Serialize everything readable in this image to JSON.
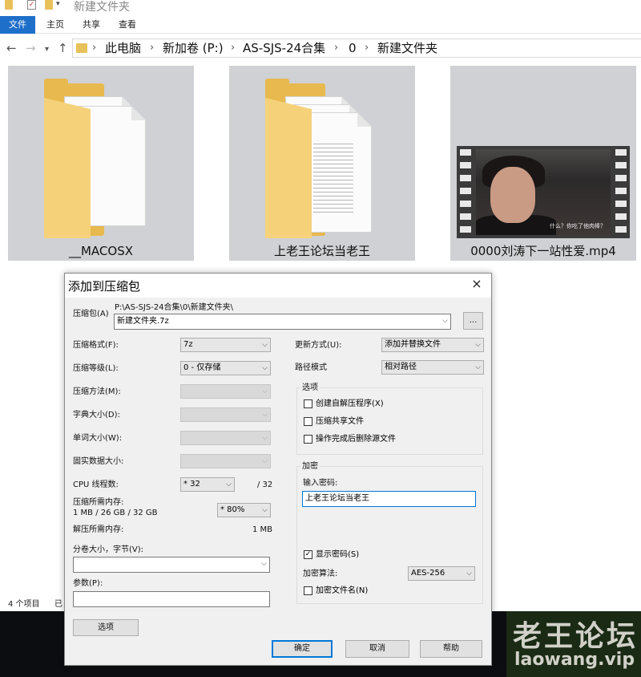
{
  "explorer": {
    "window_title": "新建文件夹",
    "ribbon_tabs": [
      "文件",
      "主页",
      "共享",
      "查看"
    ],
    "breadcrumbs": [
      "此电脑",
      "新加卷 (P:)",
      "AS-SJS-24合集",
      "0",
      "新建文件夹"
    ],
    "files": [
      {
        "name": "__MACOSX",
        "type": "folder-empty"
      },
      {
        "name": "上老王论坛当老王",
        "type": "folder-docs"
      },
      {
        "name": "0000刘涛下一站性爱.mp4",
        "type": "video",
        "subtitle": "什么？你吃了他肉棒？"
      }
    ],
    "status": {
      "count": "4 个项目",
      "selected": "已"
    }
  },
  "watermark": {
    "cn": "老王论坛",
    "en": "laowang.vip"
  },
  "dialog": {
    "title": "添加到压缩包",
    "archive_label": "压缩包(A)",
    "archive_path": "P:\\AS-SJS-24合集\\0\\新建文件夹\\",
    "archive_name": "新建文件夹.7z",
    "browse_label": "...",
    "format_label": "压缩格式(F):",
    "format_value": "7z",
    "level_label": "压缩等级(L):",
    "level_value": "0 - 仅存储",
    "method_label": "压缩方法(M):",
    "dict_label": "字典大小(D):",
    "word_label": "单词大小(W):",
    "solid_label": "固实数据大小:",
    "cpu_label": "CPU 线程数:",
    "cpu_value": "* 32",
    "cpu_total": "/ 32",
    "mem_label": "压缩所需内存:",
    "mem_detail": "1 MB / 26 GB / 32 GB",
    "mem_value": "* 80%",
    "decomp_label": "解压所需内存:",
    "decomp_value": "1 MB",
    "volume_label": "分卷大小，字节(V):",
    "volume_value": "",
    "params_label": "参数(P):",
    "params_value": "",
    "options_button": "选项",
    "update_label": "更新方式(U):",
    "update_value": "添加并替换文件",
    "path_label": "路径模式",
    "path_value": "相对路径",
    "options_group": "选项",
    "opt_sfx": "创建自解压程序(X)",
    "opt_shared": "压缩共享文件",
    "opt_delete": "操作完成后删除源文件",
    "enc_group": "加密",
    "pwd_label": "输入密码:",
    "pwd_value": "上老王论坛当老王",
    "show_pwd": "显示密码(S)",
    "enc_method_label": "加密算法:",
    "enc_method_value": "AES-256",
    "enc_names": "加密文件名(N)",
    "ok": "确定",
    "cancel": "取消",
    "help": "帮助",
    "close_icon": "×",
    "check_mark": "✓"
  }
}
